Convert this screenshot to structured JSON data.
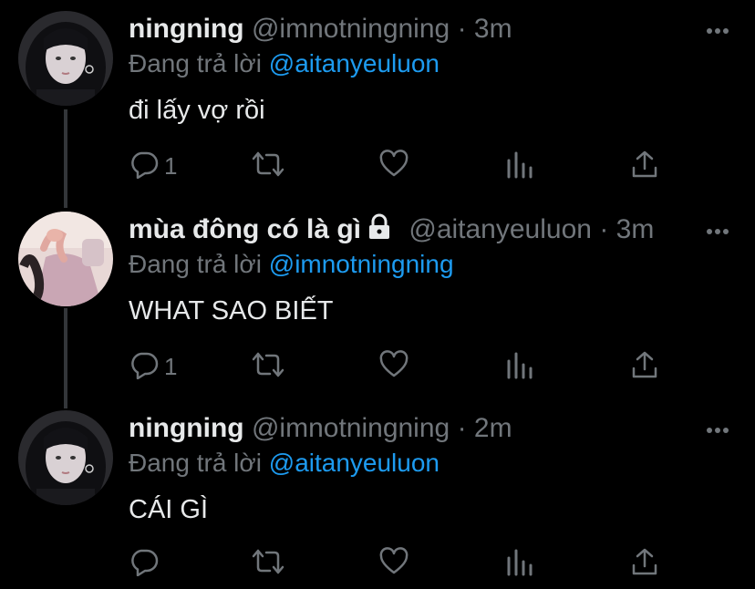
{
  "colors": {
    "background": "#000000",
    "text_primary": "#e7e9ea",
    "text_secondary": "#71767b",
    "accent": "#1d9bf0",
    "thread_line": "#333639"
  },
  "tweets": [
    {
      "display_name": "ningning",
      "handle": "@imnotningning",
      "separator": "·",
      "time": "3m",
      "protected": false,
      "reply_prefix": "Đang trả lời",
      "reply_to": "@aitanyeuluon",
      "text": "đi lấy vợ rồi",
      "reply_count": "1",
      "icons": [
        "reply-icon",
        "retweet-icon",
        "like-icon",
        "analytics-icon",
        "share-icon",
        "more-icon"
      ]
    },
    {
      "display_name": "mùa đông có là gì",
      "handle": "@aitanyeuluon",
      "separator": "·",
      "time": "3m",
      "protected": true,
      "reply_prefix": "Đang trả lời",
      "reply_to": "@imnotningning",
      "text": "WHAT SAO BIẾT",
      "reply_count": "1",
      "icons": [
        "reply-icon",
        "retweet-icon",
        "like-icon",
        "analytics-icon",
        "share-icon",
        "more-icon",
        "lock-icon"
      ]
    },
    {
      "display_name": "ningning",
      "handle": "@imnotningning",
      "separator": "·",
      "time": "2m",
      "protected": false,
      "reply_prefix": "Đang trả lời",
      "reply_to": "@aitanyeuluon",
      "text": "CÁI GÌ",
      "reply_count": "",
      "icons": [
        "reply-icon",
        "retweet-icon",
        "like-icon",
        "analytics-icon",
        "share-icon",
        "more-icon"
      ]
    }
  ]
}
